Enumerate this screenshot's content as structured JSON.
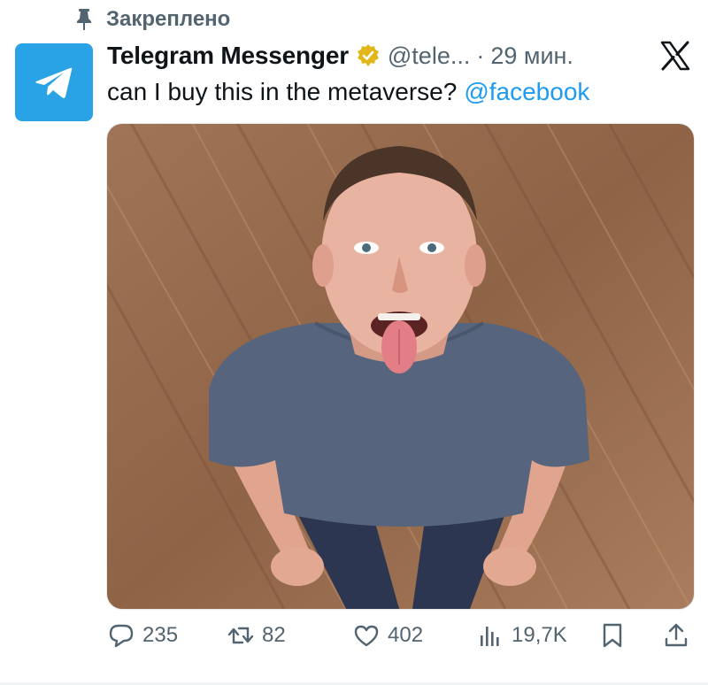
{
  "pinned": {
    "label": "Закреплено",
    "icon": "pin-icon"
  },
  "tweet": {
    "author": {
      "display_name": "Telegram Messenger",
      "handle": "@tele...",
      "verified": true,
      "avatar_icon": "telegram-plane-icon",
      "avatar_color": "#2aa3e6",
      "verified_color": "#e2b719"
    },
    "separator": "·",
    "time": "29 мин.",
    "text": "can I buy this in the metaverse?",
    "mention": "@facebook",
    "media": {
      "type": "photo",
      "alt_icon": "photo-icon"
    },
    "actions": {
      "reply_count": "235",
      "retweet_count": "82",
      "like_count": "402",
      "views_count": "19,7K"
    }
  },
  "brand": {
    "logo_icon": "x-logo-icon"
  },
  "colors": {
    "text_primary": "#0f1419",
    "text_secondary": "#536471",
    "link": "#1d9bf0"
  }
}
